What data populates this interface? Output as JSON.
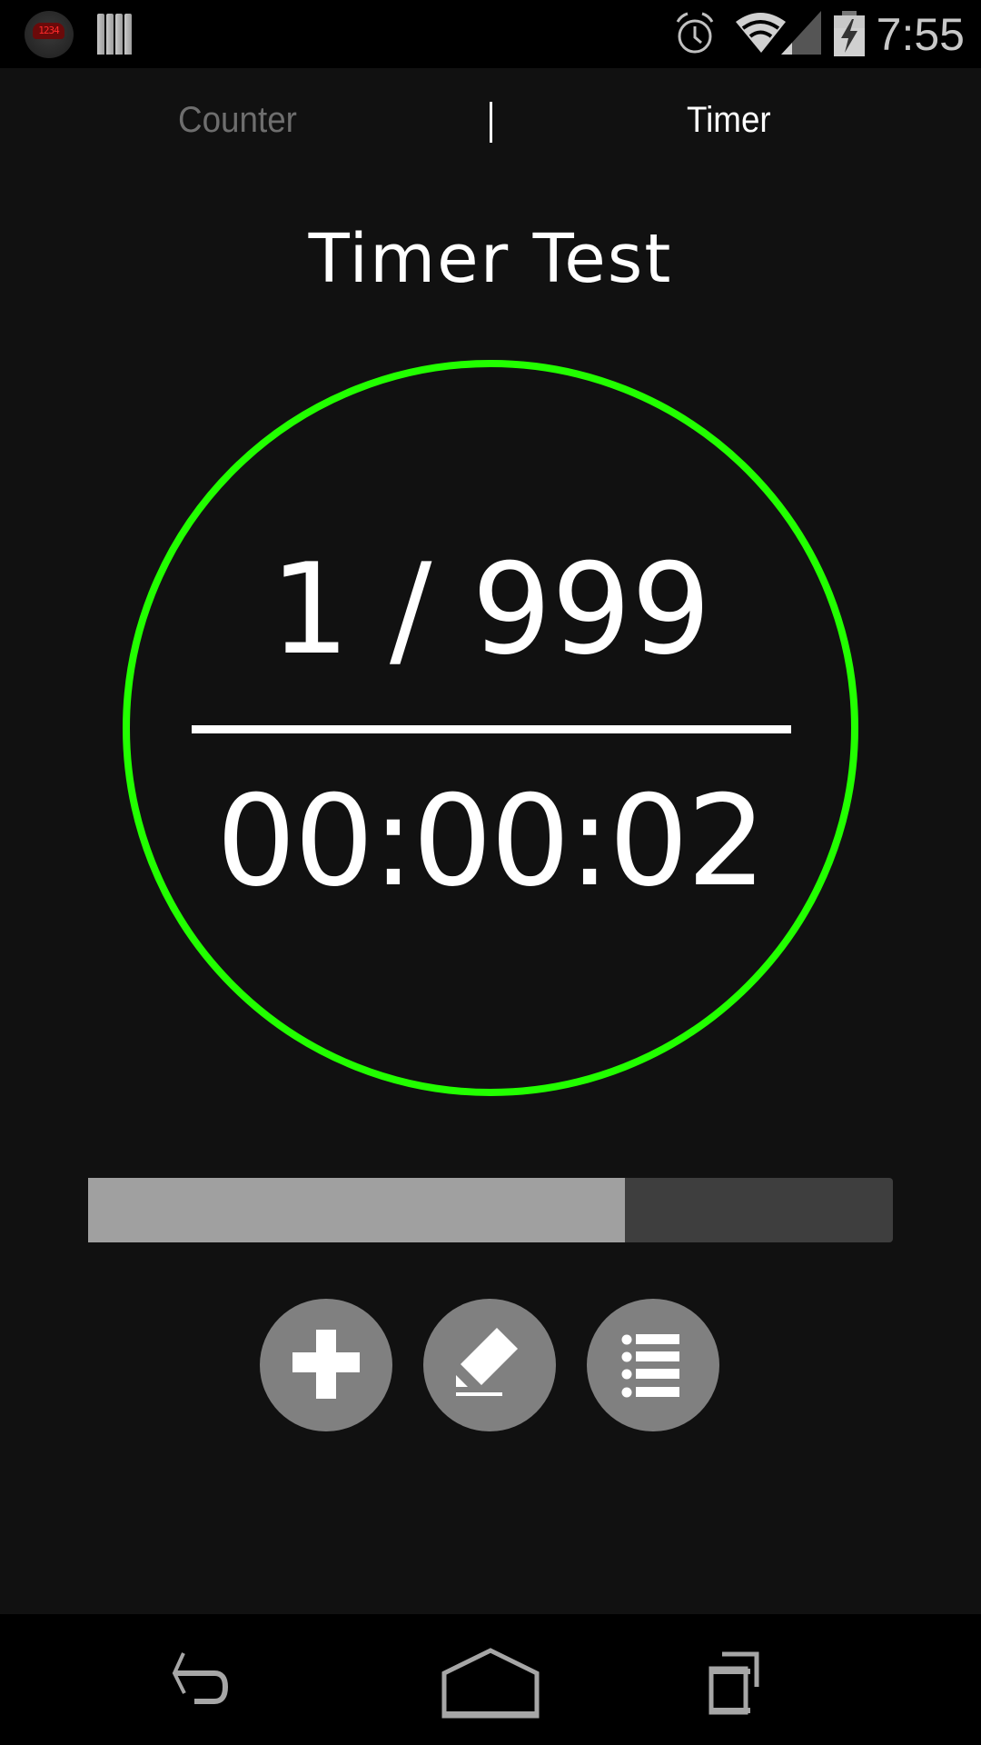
{
  "status_bar": {
    "time": "7:55",
    "app_icon_led_text": "1234",
    "icons": [
      "counter-app-icon",
      "bars-app-icon",
      "alarm-icon",
      "wifi-icon",
      "cell-signal-icon",
      "battery-charging-icon"
    ]
  },
  "tabs": [
    {
      "label": "Counter",
      "active": false
    },
    {
      "label": "Timer",
      "active": true
    }
  ],
  "main": {
    "title": "Timer Test",
    "count_display": "1 / 999",
    "elapsed_time": "00:00:02",
    "ring_color": "#22ff00",
    "progress_fraction": 0.667
  },
  "actions": [
    {
      "name": "add",
      "icon": "plus-icon"
    },
    {
      "name": "edit",
      "icon": "pencil-icon"
    },
    {
      "name": "list",
      "icon": "list-icon"
    }
  ],
  "nav_bar": {
    "buttons": [
      "back",
      "home",
      "recents"
    ]
  }
}
